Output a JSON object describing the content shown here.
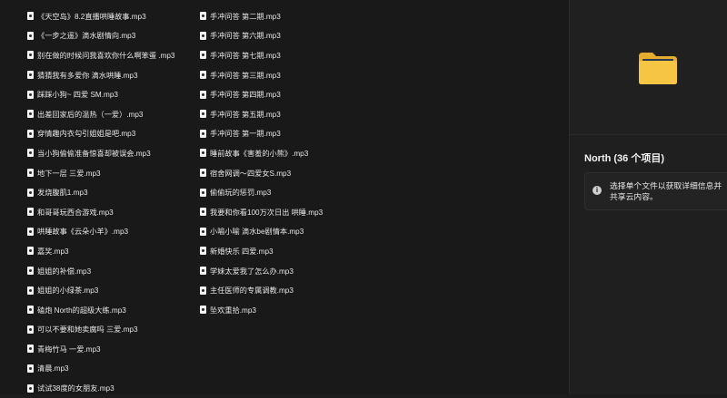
{
  "files": {
    "column1": [
      "《天空岛》8.2直播哄睡故事.mp3",
      "《一步之遥》滴水剧情向.mp3",
      "别在做的时候问我喜欢你什么啊笨蛋 .mp3",
      "猜猜我有多爱你 滴水哄睡.mp3",
      "踩踩小狗~ 四爱 SM.mp3",
      "出差回家后的温热（一爱）.mp3",
      "穿情趣内衣勾引姐姐是吧.mp3",
      "当小狗偷偷准备惊喜却被误会.mp3",
      "地下一层 三爱.mp3",
      "发烧腹肌1.mp3",
      "和哥哥玩西合游戏.mp3",
      "哄睡故事《云朵小羊》.mp3",
      "嘉奖.mp3",
      "姐姐的补偿.mp3",
      "姐姐的小绿茶.mp3",
      "磕炮 North的超级大练.mp3",
      "可以不要和她卖腐吗 三爱.mp3",
      "青梅竹马 一爱.mp3",
      "清晨.mp3",
      "试试38度的女朋友.mp3"
    ],
    "column2": [
      "手冲问答 第二期.mp3",
      "手冲问答 第六期.mp3",
      "手冲问答 第七期.mp3",
      "手冲问答 第三期.mp3",
      "手冲问答 第四期.mp3",
      "手冲问答 第五期.mp3",
      "手冲问答 第一期.mp3",
      "睡前故事《害羞的小熊》.mp3",
      "宿舍网调～四爱女S.mp3",
      "偷偷玩的惩罚.mp3",
      "我要和你看100万次日出 哄睡.mp3",
      "小喻小喻 滴水be剧情本.mp3",
      "新婚快乐 四爱.mp3",
      "学妹太爱我了怎么办.mp3",
      "主任医师的专属调教.mp3",
      "坠欢重拾.mp3"
    ]
  },
  "details": {
    "title": "North (36 个项目)",
    "info_line1": "选择单个文件以获取详细信息并",
    "info_line2": "共享云内容。",
    "folder_icon": "folder-icon",
    "info_icon": "info-icon",
    "folder_color": "#f5c543"
  }
}
